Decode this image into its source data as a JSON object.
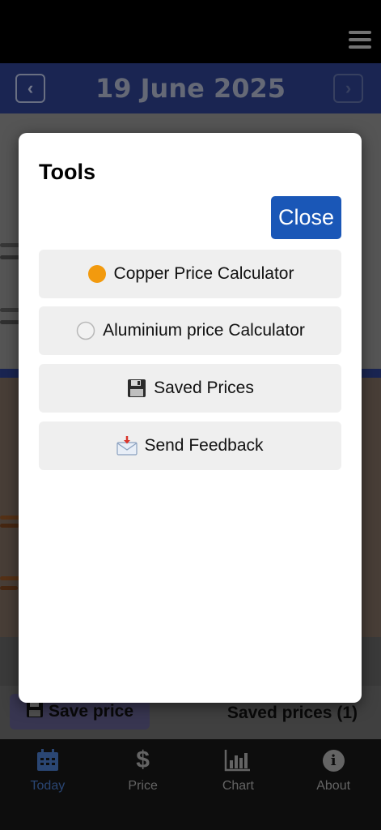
{
  "header": {
    "date": "19 June 2025",
    "prev_glyph": "‹",
    "next_glyph": "›"
  },
  "background": {
    "save_price_label": "Save price",
    "saved_prices_label": "Saved prices (1)"
  },
  "tabbar": {
    "tabs": [
      {
        "label": "Today",
        "icon": "calendar-icon",
        "active": true
      },
      {
        "label": "Price",
        "icon": "dollar-icon",
        "active": false
      },
      {
        "label": "Chart",
        "icon": "bar-chart-icon",
        "active": false
      },
      {
        "label": "About",
        "icon": "info-icon",
        "active": false
      }
    ],
    "price_glyph": "$",
    "about_glyph": "i"
  },
  "modal": {
    "title": "Tools",
    "close_label": "Close",
    "items": [
      {
        "label": "Copper Price Calculator",
        "icon": "orange-circle-icon"
      },
      {
        "label": "Aluminium price Calculator",
        "icon": "white-circle-icon"
      },
      {
        "label": "Saved Prices",
        "icon": "floppy-disk-icon"
      },
      {
        "label": "Send Feedback",
        "icon": "envelope-arrow-icon"
      }
    ]
  },
  "colors": {
    "accent": "#1a57b7",
    "header_bg": "#1c2857",
    "active_tab": "#2d4a7a"
  }
}
